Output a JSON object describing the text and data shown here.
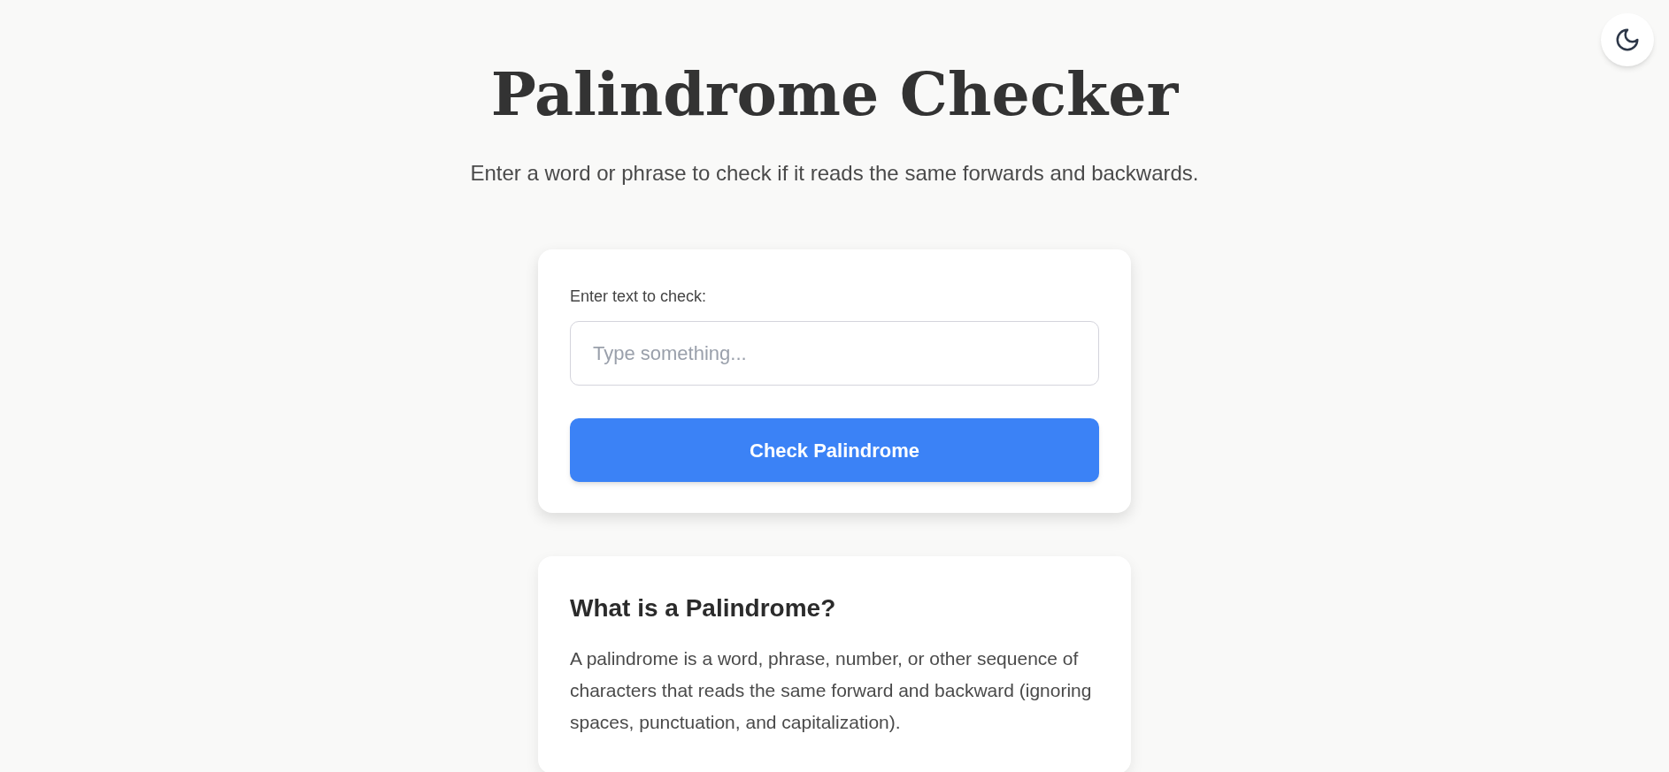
{
  "header": {
    "title": "Palindrome Checker",
    "subtitle": "Enter a word or phrase to check if it reads the same forwards and backwards."
  },
  "checker": {
    "label": "Enter text to check:",
    "placeholder": "Type something...",
    "button": "Check Palindrome"
  },
  "info": {
    "heading": "What is a Palindrome?",
    "text": "A palindrome is a word, phrase, number, or other sequence of characters that reads the same forward and backward (ignoring spaces, punctuation, and capitalization)."
  }
}
